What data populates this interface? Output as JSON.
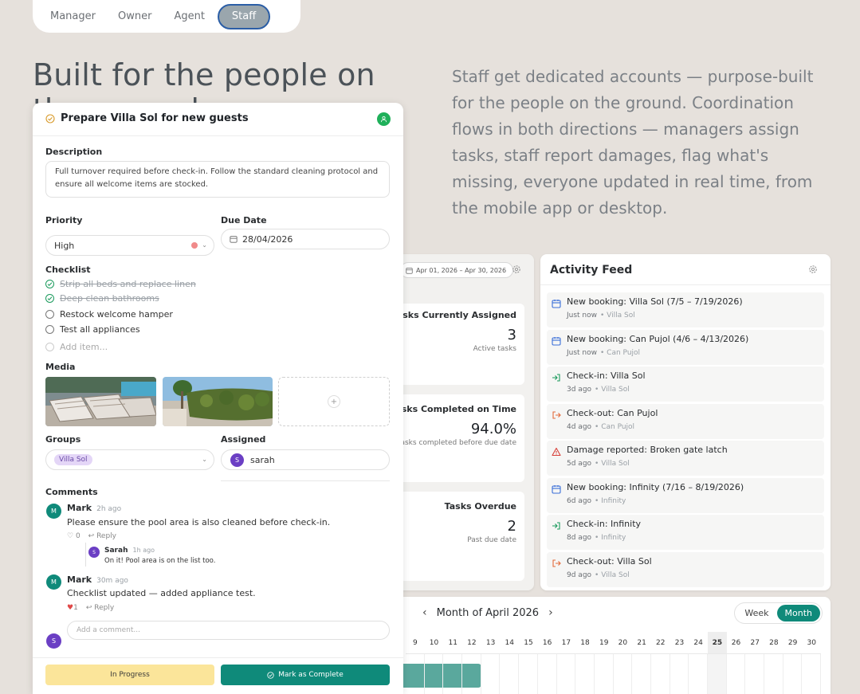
{
  "role_tabs": [
    "Manager",
    "Owner",
    "Agent",
    "Staff"
  ],
  "hero": {
    "title": "Built for the people on",
    "title_line2": "the ground",
    "description": "Staff get dedicated accounts — purpose-built for the people on the ground. Coordination flows in both directions — managers assign tasks, staff report damages, flag what's missing, everyone updated in real time, from the mobile app or desktop."
  },
  "stats": {
    "date_range": "Apr 01, 2026 – Apr 30, 2026",
    "cards": [
      {
        "title": "Tasks Currently Assigned",
        "value": "3",
        "sub": "Active tasks"
      },
      {
        "title": "Tasks Completed on Time",
        "value": "94.0%",
        "sub": "Tasks completed before due date"
      },
      {
        "title": "Tasks Overdue",
        "value": "2",
        "sub": "Past due date"
      }
    ]
  },
  "activity_feed": {
    "title": "Activity Feed",
    "items": [
      {
        "icon": "calendar-icon",
        "title": "New booking: Villa Sol (7/5 – 7/19/2026)",
        "time": "Just now",
        "location": "• Villa Sol"
      },
      {
        "icon": "calendar-icon",
        "title": "New booking: Can Pujol (4/6 – 4/13/2026)",
        "time": "Just now",
        "location": "• Can Pujol"
      },
      {
        "icon": "check-in-icon",
        "title": "Check-in: Villa Sol",
        "time": "3d ago",
        "location": "• Villa Sol"
      },
      {
        "icon": "check-out-icon",
        "title": "Check-out: Can Pujol",
        "time": "4d ago",
        "location": "• Can Pujol"
      },
      {
        "icon": "warning-icon",
        "title": "Damage reported: Broken gate latch",
        "time": "5d ago",
        "location": "• Villa Sol"
      },
      {
        "icon": "calendar-icon",
        "title": "New booking: Infinity (7/16 – 8/19/2026)",
        "time": "6d ago",
        "location": "• Infinity"
      },
      {
        "icon": "check-in-icon",
        "title": "Check-in: Infinity",
        "time": "8d ago",
        "location": "• Infinity"
      },
      {
        "icon": "check-out-icon",
        "title": "Check-out: Villa Sol",
        "time": "9d ago",
        "location": "• Villa Sol"
      }
    ]
  },
  "calendar": {
    "month_label": "Month of April 2026",
    "prev": "‹",
    "next": "›",
    "views": [
      "Week",
      "Month"
    ],
    "days": [
      "9",
      "10",
      "11",
      "12",
      "13",
      "14",
      "15",
      "16",
      "17",
      "18",
      "19",
      "20",
      "21",
      "22",
      "23",
      "24",
      "25",
      "26",
      "27",
      "28",
      "29",
      "30"
    ],
    "today": "25"
  },
  "task": {
    "title": "Prepare Villa Sol for new guests",
    "description_label": "Description",
    "description": "Full turnover required before check-in. Follow the standard cleaning protocol and ensure all welcome items are stocked.",
    "priority_label": "Priority",
    "priority": "High",
    "due_label": "Due Date",
    "due_date": "28/04/2026",
    "checklist_label": "Checklist",
    "checklist": [
      {
        "text": "Strip all beds and replace linen",
        "done": true
      },
      {
        "text": "Deep clean bathrooms",
        "done": true
      },
      {
        "text": "Restock welcome hamper",
        "done": false
      },
      {
        "text": "Test all appliances",
        "done": false
      }
    ],
    "add_item": "Add item...",
    "media_label": "Media",
    "media_add": "+",
    "groups_label": "Groups",
    "group": "Villa Sol",
    "assigned_label": "Assigned",
    "assignee_initial": "S",
    "assignee": "sarah",
    "comments_label": "Comments",
    "comments": [
      {
        "initial": "M",
        "name": "Mark",
        "time": "2h ago",
        "text": "Please ensure the pool area is also cleaned before check-in.",
        "likes": "0",
        "reply": "Reply"
      },
      {
        "initial": "M",
        "name": "Mark",
        "time": "30m ago",
        "text": "Checklist updated — added appliance test.",
        "likes": "1",
        "reply": "Reply"
      }
    ],
    "reply": {
      "initial": "S",
      "name": "Sarah",
      "time": "1h ago",
      "text": "On it! Pool area is on the list too."
    },
    "comment_placeholder": "Add a comment...",
    "commenter_initial": "S",
    "status_button": "In Progress",
    "complete_button": "Mark as Complete"
  }
}
